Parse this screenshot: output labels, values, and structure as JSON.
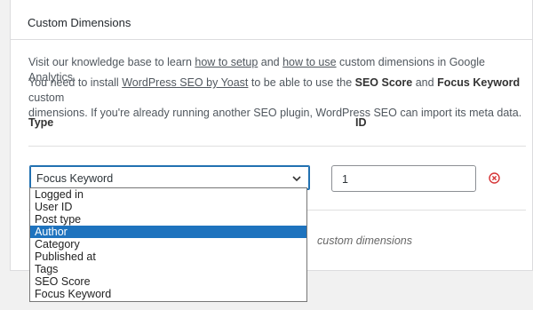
{
  "panel": {
    "title": "Custom Dimensions",
    "kb_prefix": "Visit our knowledge base to learn ",
    "kb_link_setup": "how to setup",
    "kb_and": " and ",
    "kb_link_use": "how to use",
    "kb_suffix": " custom dimensions in Google Analytics.",
    "seo_prefix": "You need to install ",
    "seo_link": "WordPress SEO by Yoast",
    "seo_mid1": " to be able to use the ",
    "seo_score": "SEO Score",
    "seo_and": " and ",
    "seo_keyword": "Focus Keyword",
    "seo_line1_end": " custom",
    "seo_line2": "dimensions. If you're already running another SEO plugin, WordPress SEO can import its meta data."
  },
  "columns": {
    "type": "Type",
    "id": "ID"
  },
  "row": {
    "selected_type": "Focus Keyword",
    "id_value": "1"
  },
  "footer_partial": "custom dimensions",
  "dropdown": {
    "options": [
      "Logged in",
      "User ID",
      "Post type",
      "Author",
      "Category",
      "Published at",
      "Tags",
      "SEO Score",
      "Focus Keyword"
    ],
    "highlighted": "Author"
  },
  "colors": {
    "accent": "#1e73be",
    "remove": "#d63638"
  },
  "icons": {
    "select_arrow": "chevron-down-icon",
    "remove": "remove-circle-icon"
  }
}
